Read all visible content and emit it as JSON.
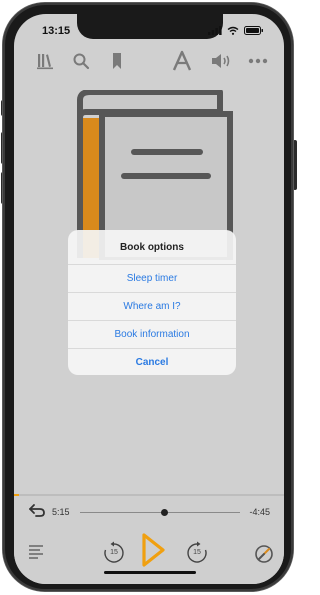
{
  "status_bar": {
    "time": "13:15",
    "icons": [
      "signal-icon",
      "wifi-icon",
      "battery-icon"
    ]
  },
  "toolbar": {
    "icons": [
      "library-icon",
      "search-icon",
      "bookmark-icon",
      "font-icon",
      "speaker-icon",
      "more-icon"
    ]
  },
  "cover": {
    "icon": "book-cover-icon",
    "colors": {
      "outline": "#575757",
      "spine": "#d98a1c",
      "page": "#c8c8c8"
    }
  },
  "dialog": {
    "title": "Book options",
    "items": [
      {
        "label": "Sleep timer"
      },
      {
        "label": "Where am I?"
      },
      {
        "label": "Book information"
      },
      {
        "label": "Cancel"
      }
    ]
  },
  "player": {
    "elapsed": "5:15",
    "remaining": "-4:45",
    "progress": 0.525,
    "overall_progress": 0.02,
    "skip_back_seconds": "15",
    "skip_forward_seconds": "15",
    "icons": [
      "back-icon",
      "chapters-icon",
      "rewind-15-icon",
      "play-icon",
      "forward-15-icon",
      "speed-icon"
    ],
    "colors": {
      "accent": "#f0a010",
      "link": "#2a7ae2"
    }
  }
}
